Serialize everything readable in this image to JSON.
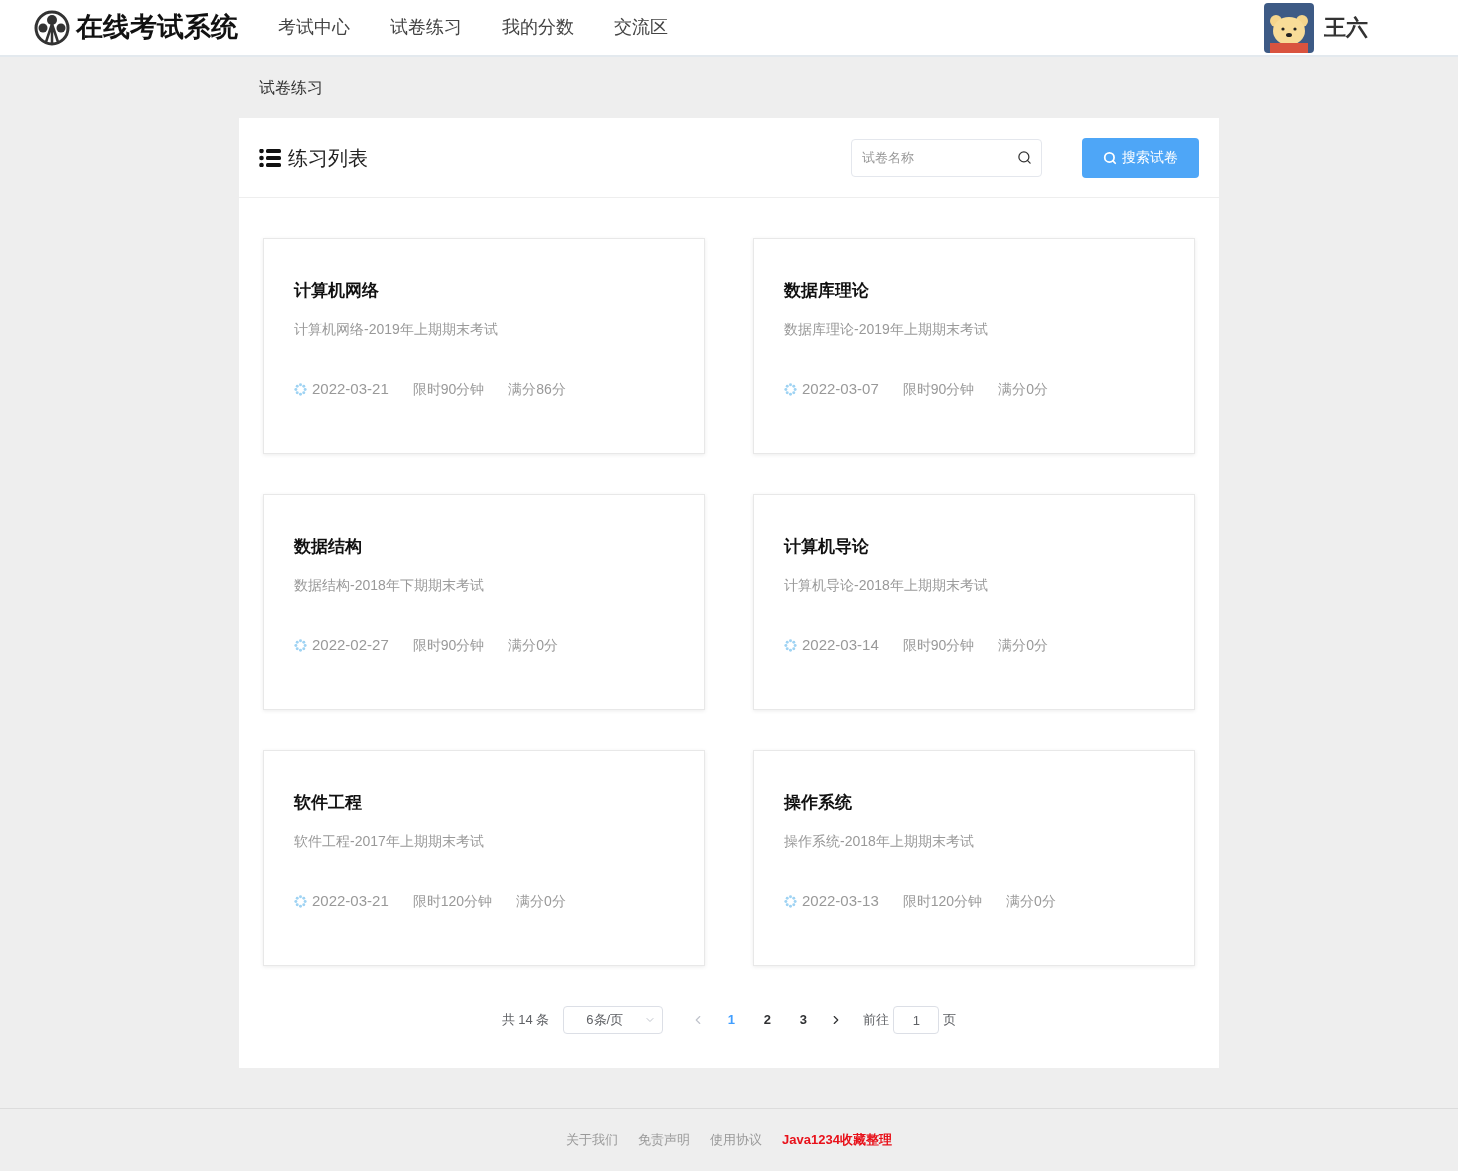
{
  "header": {
    "logo_text": "在线考试系统",
    "nav": [
      "考试中心",
      "试卷练习",
      "我的分数",
      "交流区"
    ],
    "user_name": "王六"
  },
  "breadcrumb": "试卷练习",
  "panel": {
    "title": "练习列表",
    "search": {
      "placeholder": "试卷名称"
    },
    "search_button": "搜索试卷"
  },
  "papers": [
    {
      "name": "计算机网络",
      "description": "计算机网络-2019年上期期末考试",
      "date": "2022-03-21",
      "time_limit": "限时90分钟",
      "full_score": "满分86分"
    },
    {
      "name": "数据库理论",
      "description": "数据库理论-2019年上期期末考试",
      "date": "2022-03-07",
      "time_limit": "限时90分钟",
      "full_score": "满分0分"
    },
    {
      "name": "数据结构",
      "description": "数据结构-2018年下期期末考试",
      "date": "2022-02-27",
      "time_limit": "限时90分钟",
      "full_score": "满分0分"
    },
    {
      "name": "计算机导论",
      "description": "计算机导论-2018年上期期末考试",
      "date": "2022-03-14",
      "time_limit": "限时90分钟",
      "full_score": "满分0分"
    },
    {
      "name": "软件工程",
      "description": "软件工程-2017年上期期末考试",
      "date": "2022-03-21",
      "time_limit": "限时120分钟",
      "full_score": "满分0分"
    },
    {
      "name": "操作系统",
      "description": "操作系统-2018年上期期末考试",
      "date": "2022-03-13",
      "time_limit": "限时120分钟",
      "full_score": "满分0分"
    }
  ],
  "pagination": {
    "total": "共 14 条",
    "page_size": "6条/页",
    "pages": [
      {
        "label": "1",
        "selected": true
      },
      {
        "label": "2",
        "selected": false
      },
      {
        "label": "3",
        "selected": false
      }
    ],
    "goto_label": "前往",
    "goto_value": "1",
    "goto_suffix": "页"
  },
  "footer": [
    {
      "label": "关于我们",
      "kind": "link"
    },
    {
      "label": "免责声明",
      "kind": "link"
    },
    {
      "label": "使用协议",
      "kind": "link"
    },
    {
      "label": "Java1234收藏整理",
      "kind": "highlight"
    }
  ]
}
